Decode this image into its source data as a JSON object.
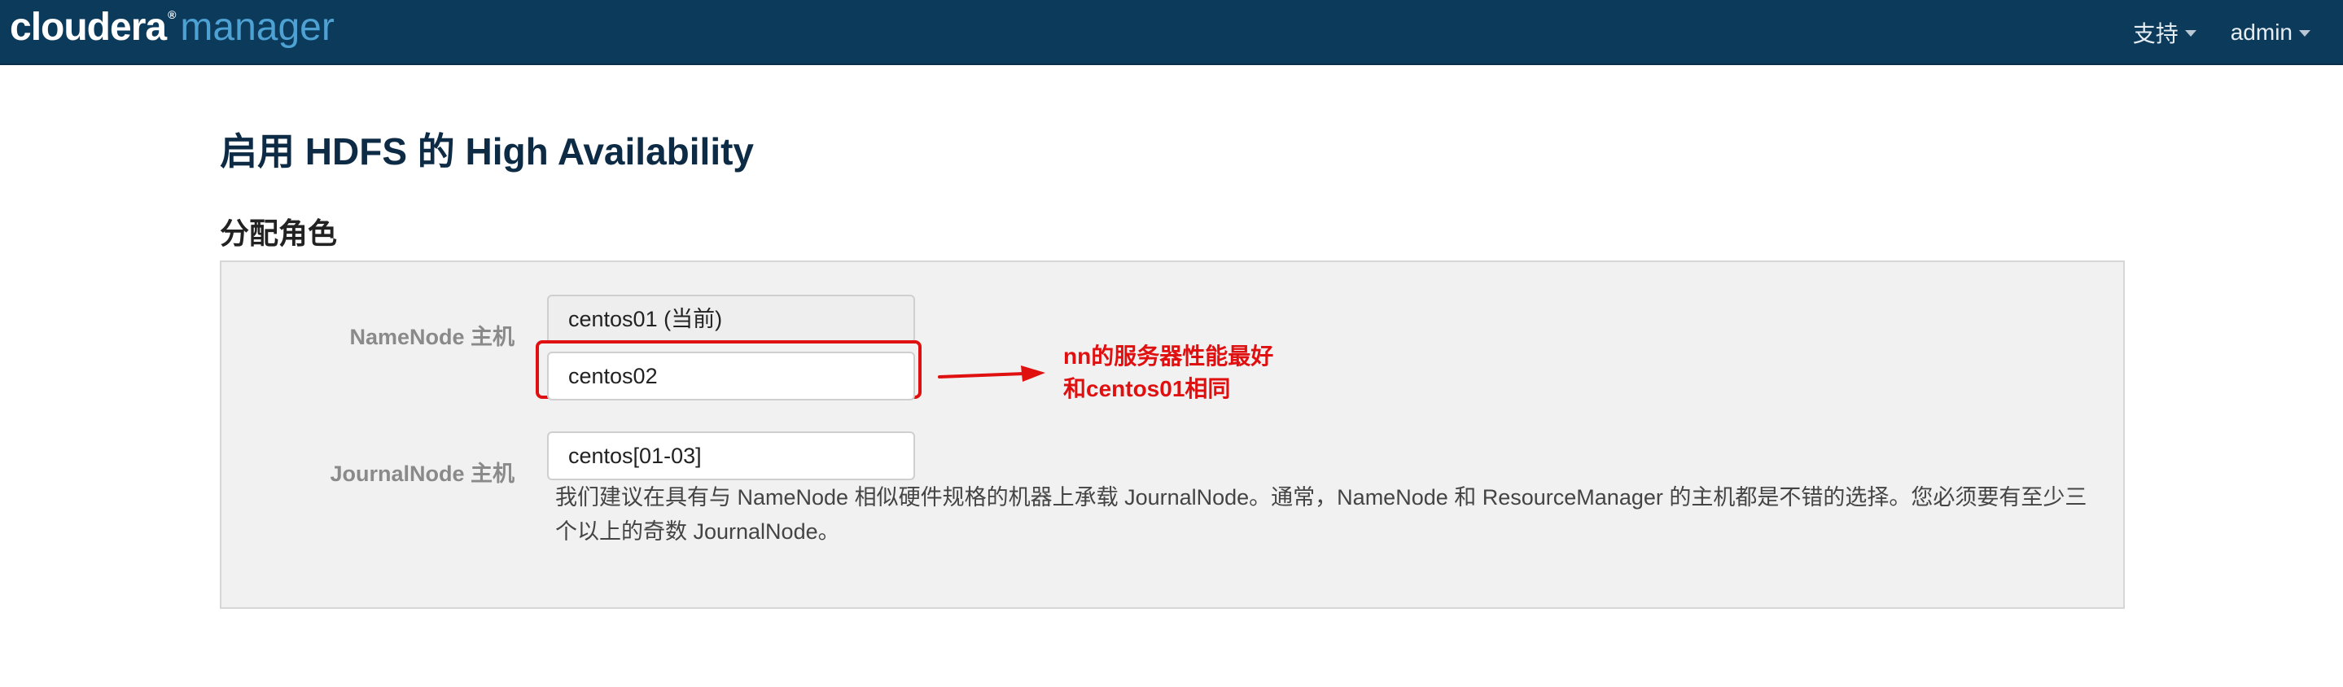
{
  "navbar": {
    "brand_primary": "cloudera",
    "brand_reg": "®",
    "brand_secondary": "manager",
    "support_label": "支持",
    "user_label": "admin",
    "colors": {
      "background": "#0c3a5b",
      "brand_secondary": "#4ea1d3"
    }
  },
  "page": {
    "title": "启用 HDFS 的 High Availability",
    "section_title": "分配角色"
  },
  "assign_roles": {
    "namenode_label": "NameNode 主机",
    "namenode_current": "centos01 (当前)",
    "namenode_second": "centos02",
    "journalnode_label": "JournalNode 主机",
    "journalnode_value": "centos[01-03]",
    "journalnode_help": "我们建议在具有与 NameNode 相似硬件规格的机器上承载 JournalNode。通常，NameNode 和 ResourceManager 的主机都是不错的选择。您必须要有至少三个以上的奇数 JournalNode。"
  },
  "annotation": {
    "text": "nn的服务器性能最好\n和centos01相同",
    "color": "#e01010"
  }
}
